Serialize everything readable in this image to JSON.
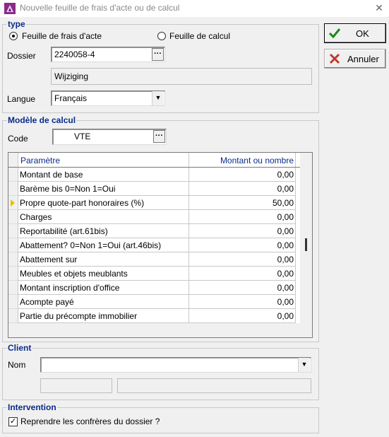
{
  "window": {
    "title": "Nouvelle feuille de frais d'acte ou de calcul",
    "close_glyph": "✕"
  },
  "type_group": {
    "legend": "type",
    "option_acte": "Feuille de frais d'acte",
    "option_calcul": "Feuille de calcul",
    "selected": "option_acte",
    "dossier_label": "Dossier",
    "dossier_value": "2240058-4",
    "dossier_button": "···",
    "dossier_name": "Wijziging",
    "langue_label": "Langue",
    "langue_value": "Français"
  },
  "buttons": {
    "ok": "OK",
    "cancel": "Annuler"
  },
  "modele_group": {
    "legend": "Modèle de calcul",
    "code_label": "Code",
    "code_value": "VTE",
    "code_button": "···",
    "columns": [
      "Paramètre",
      "Montant ou nombre"
    ],
    "current_row": 2,
    "rows": [
      {
        "param": "Montant de base",
        "value": "0,00"
      },
      {
        "param": "Barème bis 0=Non 1=Oui",
        "value": "0,00"
      },
      {
        "param": "Propre quote-part honoraires (%)",
        "value": "50,00"
      },
      {
        "param": "Charges",
        "value": "0,00"
      },
      {
        "param": "Reportabilité (art.61bis)",
        "value": "0,00"
      },
      {
        "param": "Abattement? 0=Non 1=Oui (art.46bis)",
        "value": "0,00"
      },
      {
        "param": "Abattement sur",
        "value": "0,00"
      },
      {
        "param": "Meubles et objets meublants",
        "value": "0,00"
      },
      {
        "param": "Montant inscription d'office",
        "value": "0,00"
      },
      {
        "param": "Acompte payé",
        "value": "0,00"
      },
      {
        "param": "Partie du précompte immobilier",
        "value": "0,00"
      }
    ]
  },
  "client_group": {
    "legend": "Client",
    "nom_label": "Nom",
    "nom_value": ""
  },
  "intervention_group": {
    "legend": "Intervention",
    "checkbox_label": "Reprendre les confrères du dossier ?",
    "checked": true,
    "check_glyph": "✓"
  },
  "colors": {
    "accent": "#0a2c8a",
    "ok_check": "#1a8a1a",
    "cancel_x": "#c0392b",
    "row_pointer": "#e6c000"
  }
}
